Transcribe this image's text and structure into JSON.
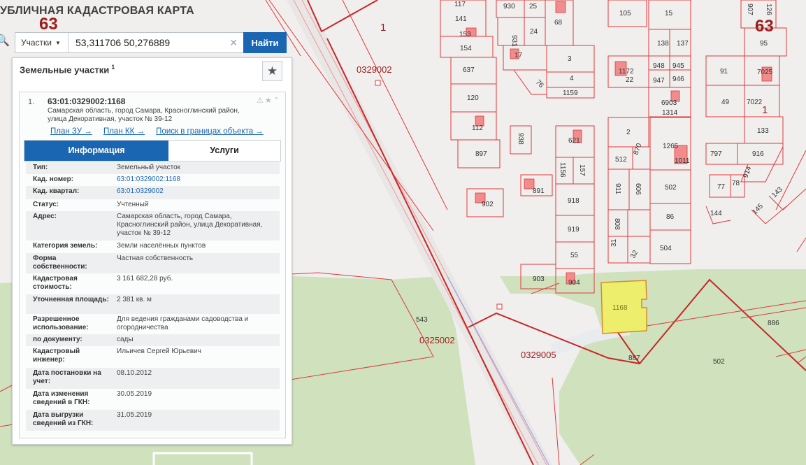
{
  "map": {
    "title": "УБЛИЧНАЯ КАДАСТРОВАЯ КАРТА",
    "region_codes": [
      "63",
      "63"
    ],
    "quarters": [
      "0329002",
      "0325002",
      "0329005"
    ],
    "parcel_labels": [
      "117",
      "141",
      "153",
      "154",
      "637",
      "120",
      "112",
      "897",
      "930",
      "25",
      "68",
      "931",
      "24",
      "17",
      "3",
      "76",
      "4",
      "1159",
      "105",
      "15",
      "138",
      "137",
      "948",
      "945",
      "947",
      "946",
      "6903",
      "1314",
      "1172",
      "22",
      "91",
      "7025",
      "49",
      "7022",
      "133",
      "95",
      "907",
      "126",
      "938",
      "621",
      "1156",
      "157",
      "918",
      "919",
      "55",
      "891",
      "902",
      "903",
      "904",
      "2",
      "512",
      "870",
      "1265",
      "1011",
      "911",
      "606",
      "502",
      "86",
      "808",
      "31",
      "32",
      "504",
      "797",
      "916",
      "77",
      "78",
      "914",
      "144",
      "145",
      "143",
      "1168",
      "543",
      "887",
      "502",
      "886",
      "1",
      "1",
      "1"
    ],
    "selected_parcel": "1168",
    "colors": {
      "background": "#f0efee",
      "forest": "#cfe2bd",
      "border": "#e0393b",
      "selected": "#ecee6c",
      "accent": "#1a66b3"
    }
  },
  "search": {
    "type_label": "Участки",
    "query": "53,311706 50,276889",
    "button_label": "Найти"
  },
  "panel": {
    "title": "Земельные участки",
    "count": "1",
    "item": {
      "index": "1.",
      "title": "63:01:0329002:1168",
      "address": "Самарская область, город Самара, Красноглинский район, улица Декоративная, участок № 39-12",
      "links": [
        "План ЗУ →",
        "План КК →",
        "Поиск в границах объекта →"
      ],
      "tabs": [
        "Информация",
        "Услуги"
      ],
      "rows": [
        {
          "key": "Тип:",
          "value": "Земельный участок"
        },
        {
          "key": "Кад. номер:",
          "value": "63:01:0329002:1168"
        },
        {
          "key": "Кад. квартал:",
          "value": "63:01:0329002"
        },
        {
          "key": "Статус:",
          "value": "Учтенный"
        },
        {
          "key": "Адрес:",
          "value": "Самарская область, город Самара, Красноглинский район, улица Декоративная, участок № 39-12"
        },
        {
          "key": "Категория земель:",
          "value": "Земли населённых пунктов"
        },
        {
          "key": "Форма собственности:",
          "value": "Частная собственность"
        },
        {
          "key": "Кадастровая стоимость:",
          "value": "3 161 682,28 руб."
        },
        {
          "key": "Уточненная площадь:",
          "value": "2 381 кв. м"
        },
        {
          "key": "Разрешенное использование:",
          "value": "Для ведения гражданами садоводства и огородничества"
        },
        {
          "key": "по документу:",
          "value": "сады"
        },
        {
          "key": "Кадастровый инженер:",
          "value": "Ильичев Сергей Юрьевич"
        },
        {
          "key": "Дата постановки на учет:",
          "value": "08.10.2012"
        },
        {
          "key": "Дата изменения сведений в ГКН:",
          "value": "30.05.2019"
        },
        {
          "key": "Дата выгрузки сведений из ГКН:",
          "value": "31.05.2019"
        }
      ]
    }
  }
}
